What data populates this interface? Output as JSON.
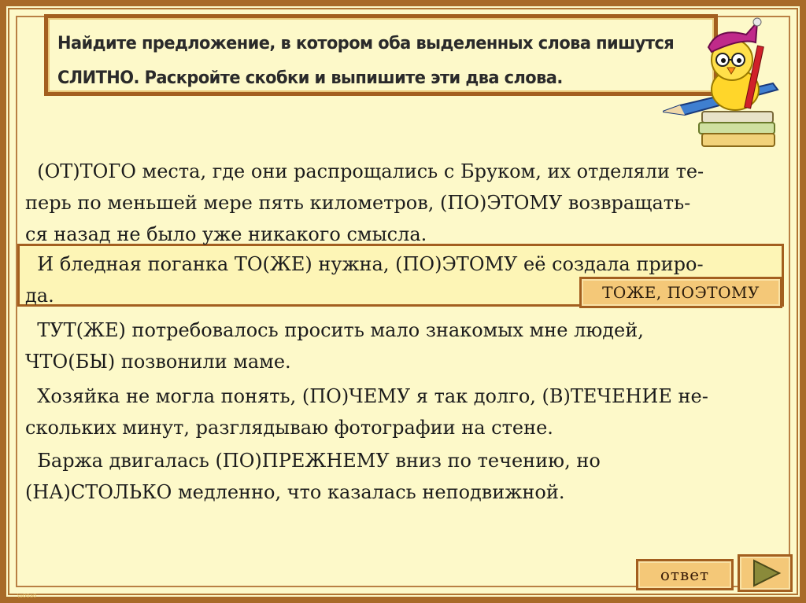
{
  "task": {
    "line1": "Найдите предложение, в котором оба выделенных слова пишутся",
    "line2": "СЛИТНО. Раскройте скобки и выпишите эти два слова."
  },
  "sentences": [
    {
      "lines": [
        "  (ОТ)ТОГО места, где они распрощались с Бруком, их отделяли те-",
        "перь по меньшей мере пять километров, (ПО)ЭТОМУ возвращать-",
        "ся назад не было уже никакого смысла."
      ]
    },
    {
      "lines": [
        "  И бледная поганка ТО(ЖЕ) нужна, (ПО)ЭТОМУ её создала приро-",
        "да."
      ]
    },
    {
      "lines": [
        "  ТУТ(ЖЕ) потребовалось просить мало знакомых мне людей,",
        "ЧТО(БЫ) позвонили маме."
      ]
    },
    {
      "lines": [
        "  Хозяйка не могла понять, (ПО)ЧЕМУ я так долго, (В)ТЕЧЕНИЕ не-",
        "скольких минут, разглядываю фотографии на стене."
      ]
    },
    {
      "lines": [
        "  Баржа двигалась (ПО)ПРЕЖНЕМУ вниз по течению, но",
        "(НА)СТОЛЬКО медленно, что казалась неподвижной."
      ]
    }
  ],
  "answer_popup": "ТОЖЕ, ПОЭТОМУ",
  "buttons": {
    "answer_label": "ответ",
    "next_icon": "play-triangle-icon"
  },
  "mascot_icon": "chick-on-books-with-pencil",
  "colors": {
    "background": "#fdf9c9",
    "border": "#a35f1f",
    "button": "#f4c878",
    "arrow": "#8a8a3a"
  }
}
